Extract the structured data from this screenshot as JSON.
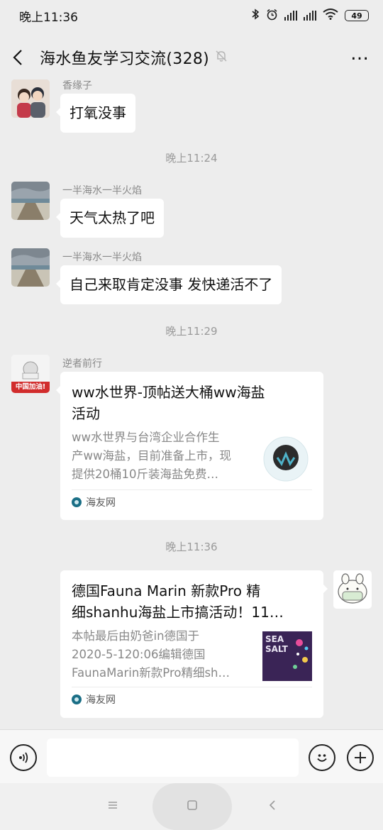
{
  "status_bar": {
    "time": "晚上11:36",
    "battery": "49"
  },
  "header": {
    "title": "海水鱼友学习交流(328)"
  },
  "messages": [
    {
      "sender": "香缘子",
      "text": "打氧没事"
    },
    {
      "time": "晚上11:24"
    },
    {
      "sender": "一半海水一半火焰",
      "text": "天气太热了吧"
    },
    {
      "sender": "一半海水一半火焰",
      "text": "自己来取肯定没事 发快递活不了"
    },
    {
      "time": "晚上11:29"
    },
    {
      "sender": "逆者前行",
      "avatar_caption": "中国加油!",
      "card": {
        "title_lines": [
          "ww水世界-顶帖送大桶ww海盐",
          "活动"
        ],
        "desc_lines": [
          "ww水世界与台湾企业合作生",
          "产ww海盐，目前准备上市，现",
          "提供20桶10斤装海盐免费…"
        ],
        "source": "海友网"
      }
    },
    {
      "time": "晚上11:36"
    },
    {
      "card": {
        "title_lines": [
          "德国Fauna Marin 新款Pro 精",
          "细shanhu海盐上市搞活动！11…"
        ],
        "desc_lines": [
          "本帖最后由奶爸in德国于",
          "2020-5-120:06编辑德国",
          "FaunaMarin新款Pro精细sh…"
        ],
        "source": "海友网",
        "thumb_text": "SEA SALT"
      }
    }
  ],
  "colors": {
    "background": "#ededed",
    "bubble": "#ffffff",
    "timestamp": "#9a9a9a"
  },
  "icons": [
    "bluetooth-icon",
    "alarm-icon",
    "signal-icon",
    "wifi-icon",
    "battery-icon",
    "back-icon",
    "mute-bell-icon",
    "more-icon",
    "voice-icon",
    "emoji-icon",
    "plus-icon",
    "menu-icon",
    "home-icon",
    "nav-back-icon"
  ]
}
